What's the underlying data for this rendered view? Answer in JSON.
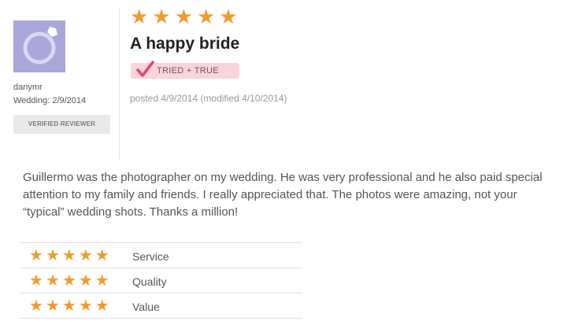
{
  "colors": {
    "star": "#f29b2e",
    "badge_background": "#fbd3dd",
    "check": "#e0457b",
    "avatar": "#a9a6d9"
  },
  "reviewer": {
    "name": "danymr",
    "wedding": "Wedding: 2/9/2014",
    "badge": "VERIFIED REVIEWER",
    "avatar_icon": "ring-icon"
  },
  "review": {
    "rating": 5,
    "title": "A happy bride",
    "tried_badge": "TRIED + TRUE",
    "posted": "posted 4/9/2014 (modified 4/10/2014)",
    "body": "Guillermo was the photographer on my wedding. He was very professional and he also paid special attention to my family and friends. I really appreciated that. The photos were amazing, not your “typical” wedding shots. Thanks a million!"
  },
  "ratings": [
    {
      "label": "Service",
      "stars": 5
    },
    {
      "label": "Quality",
      "stars": 5
    },
    {
      "label": "Value",
      "stars": 5
    }
  ]
}
